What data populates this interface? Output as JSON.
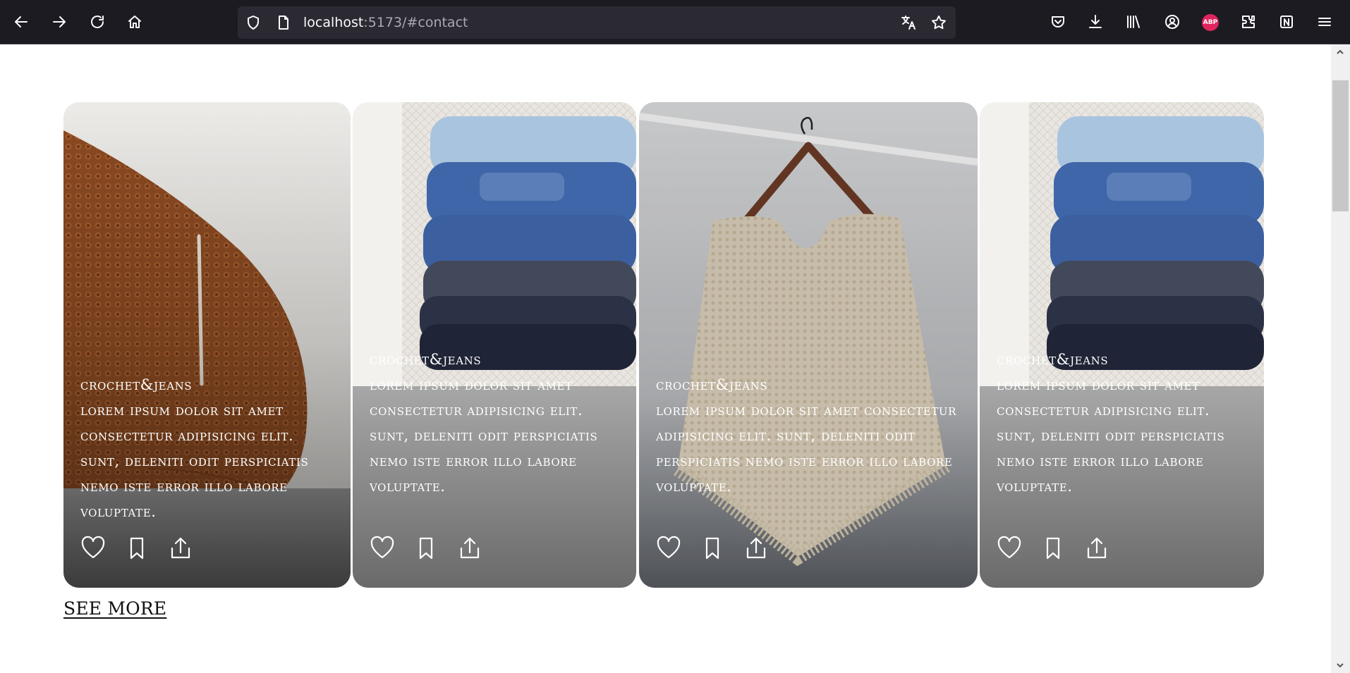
{
  "browser": {
    "url_host": "localhost",
    "url_rest": ":5173/#contact"
  },
  "cards": [
    {
      "brand": "crochet&jeans",
      "text": "Lorem ipsum dolor sit amet consectetur adipisicing elit. Sunt, deleniti odit perspiciatis nemo iste error illo labore voluptate."
    },
    {
      "brand": "crochet&jeans",
      "text": "Lorem ipsum dolor sit amet consectetur adipisicing elit. Sunt, deleniti odit perspiciatis nemo iste error illo labore voluptate."
    },
    {
      "brand": "crochet&jeans",
      "text": "Lorem ipsum dolor sit amet consectetur adipisicing elit. Sunt, deleniti odit perspiciatis nemo iste error illo labore voluptate."
    },
    {
      "brand": "crochet&jeans",
      "text": "Lorem ipsum dolor sit amet consectetur adipisicing elit. Sunt, deleniti odit perspiciatis nemo iste error illo labore voluptate."
    }
  ],
  "see_more": "SEE MORE",
  "icons": {
    "card_actions": [
      "heart-icon",
      "bookmark-icon",
      "share-icon"
    ]
  }
}
